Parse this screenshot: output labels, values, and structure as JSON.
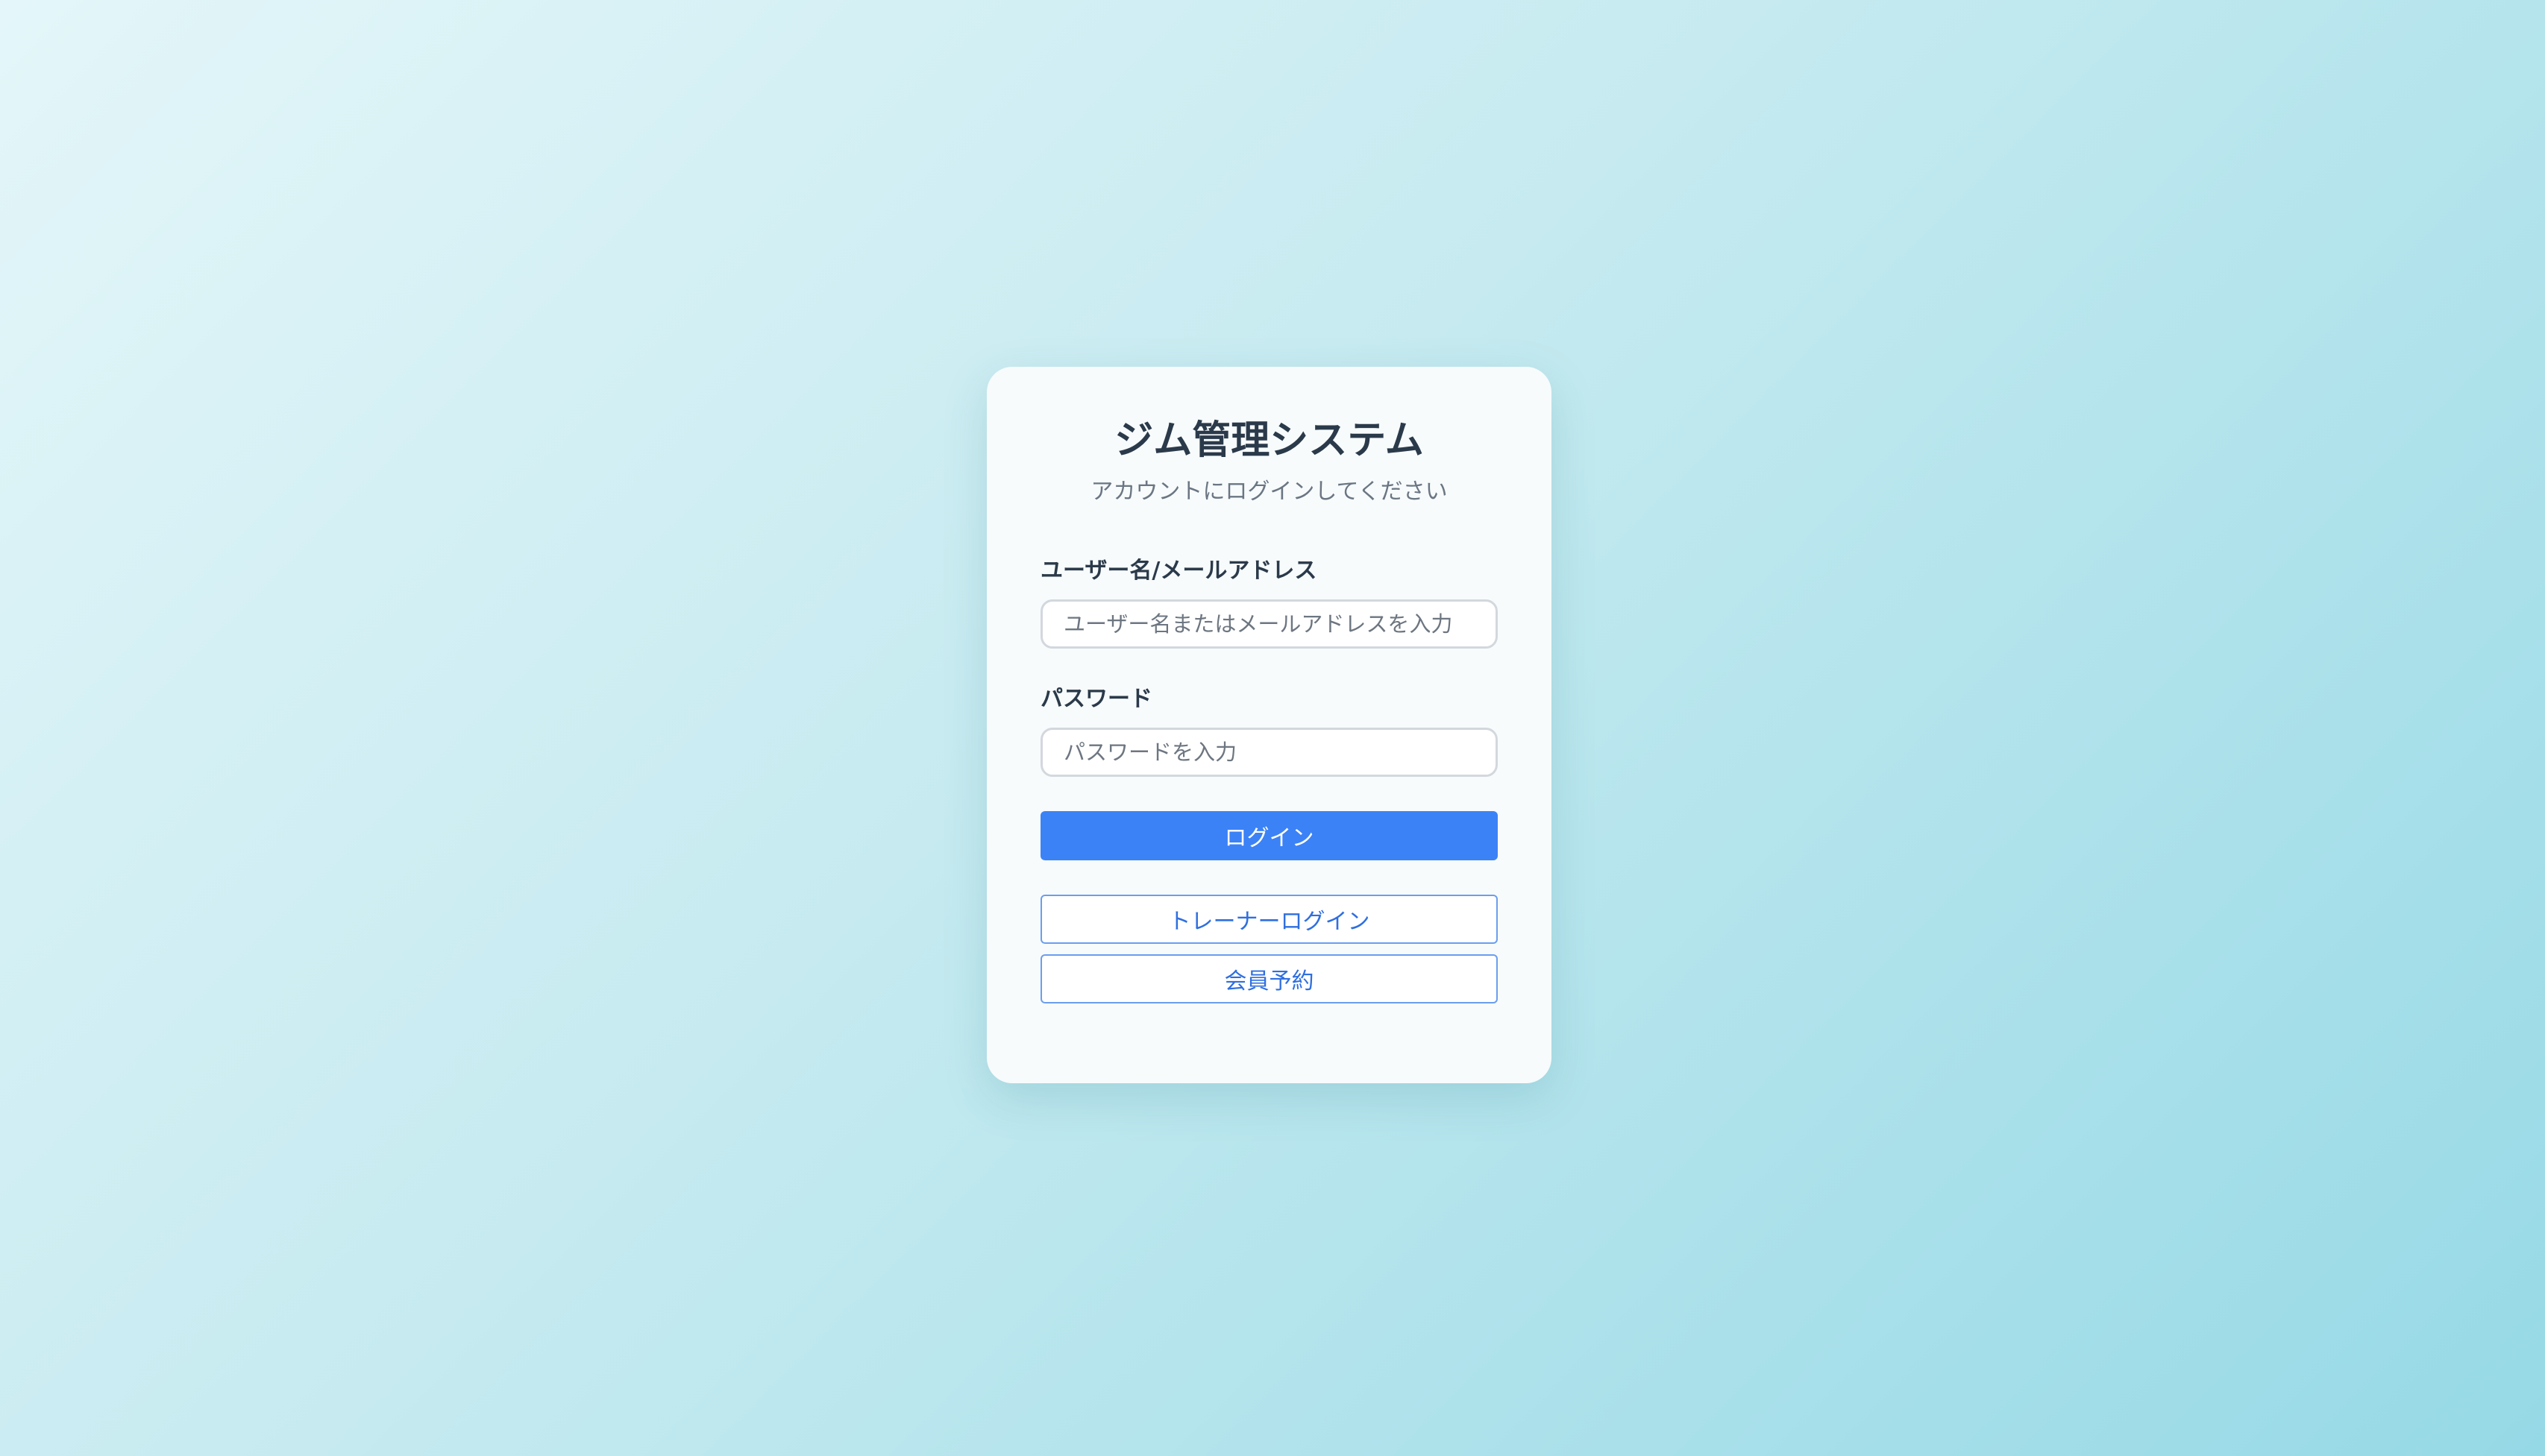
{
  "login": {
    "title": "ジム管理システム",
    "subtitle": "アカウントにログインしてください",
    "username": {
      "label": "ユーザー名/メールアドレス",
      "placeholder": "ユーザー名またはメールアドレスを入力",
      "value": ""
    },
    "password": {
      "label": "パスワード",
      "placeholder": "パスワードを入力",
      "value": ""
    },
    "login_button": "ログイン",
    "trainer_login_button": "トレーナーログイン",
    "member_booking_button": "会員予約"
  },
  "colors": {
    "primary": "#3b82f6",
    "outline_border": "#6a9ef0",
    "card_background": "#f7fbfc",
    "page_gradient_start": "#e4f6f9",
    "page_gradient_end": "#96d9e6"
  }
}
